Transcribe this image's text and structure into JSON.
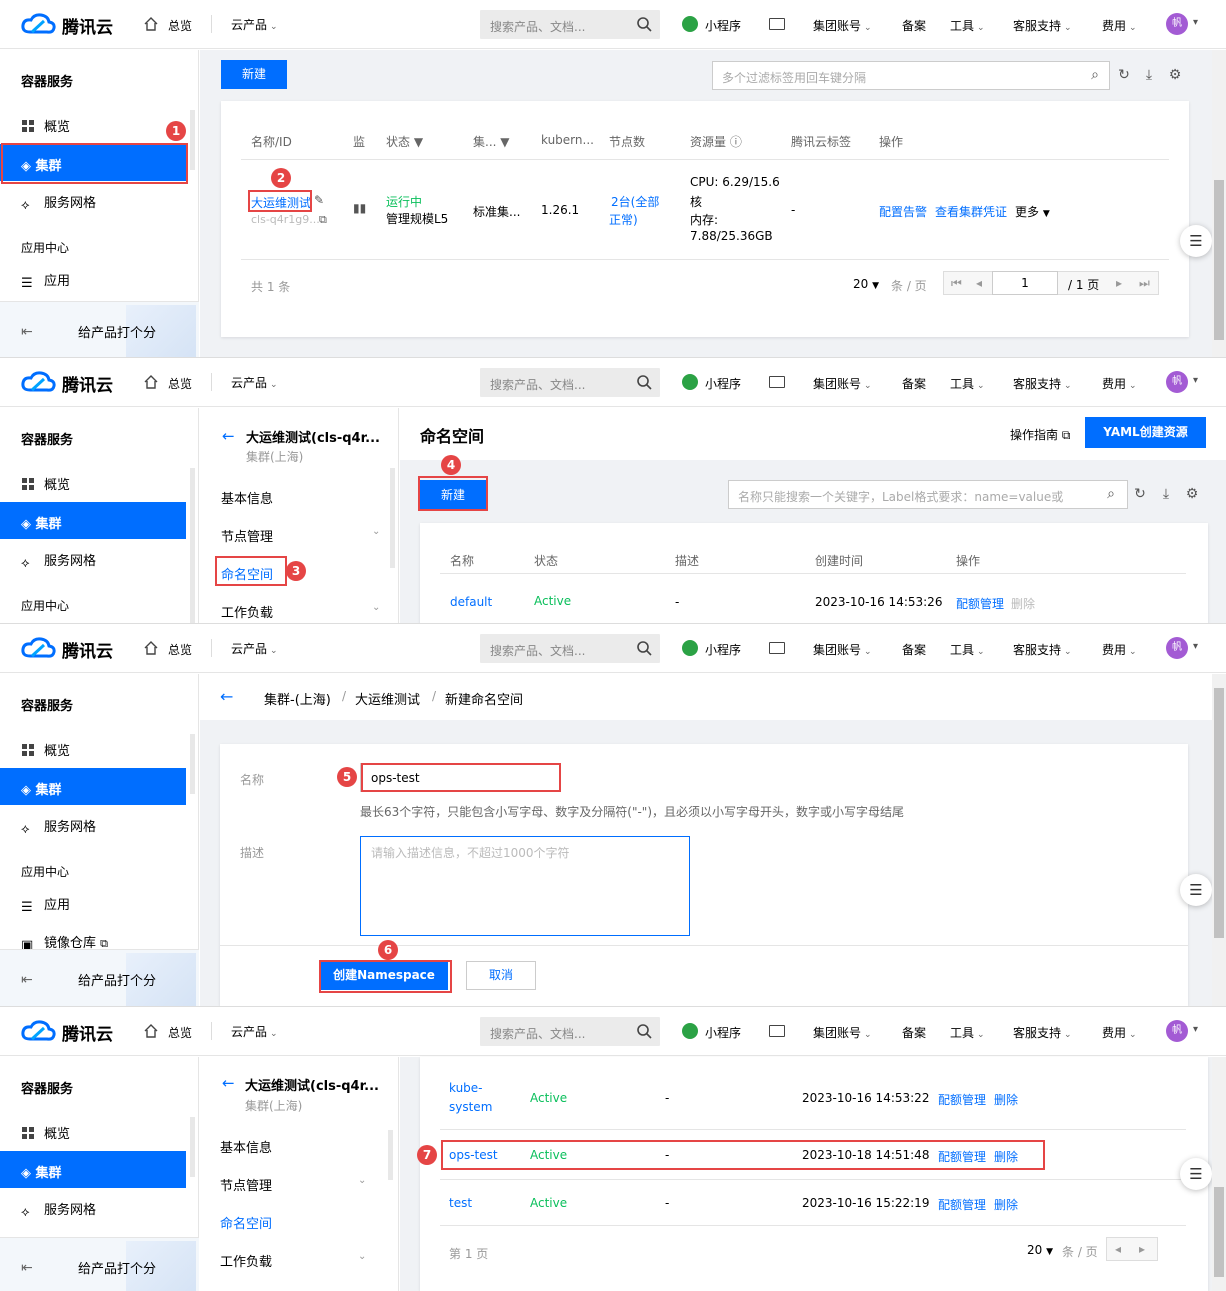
{
  "topbar": {
    "brand": "腾讯云",
    "overview": "总览",
    "products": "云产品",
    "search_placeholder": "搜索产品、文档...",
    "miniprogram": "小程序",
    "group_account": "集团账号",
    "filing": "备案",
    "tools": "工具",
    "support": "客服支持",
    "billing": "费用",
    "avatar": "帆"
  },
  "sidebar": {
    "title": "容器服务",
    "overview": "概览",
    "cluster": "集群",
    "service_mesh": "服务网格",
    "app_center": "应用中心",
    "app": "应用",
    "image_repo": "镜像仓库",
    "rate": "给产品打个分"
  },
  "panel1": {
    "new_button": "新建",
    "filter_placeholder": "多个过滤标签用回车键分隔",
    "columns": [
      "名称/ID",
      "监",
      "状态",
      "集...",
      "kubern...",
      "节点数",
      "资源量",
      "腾讯云标签",
      "操作"
    ],
    "row": {
      "name": "大运维测试",
      "id": "cls-q4r1g9...",
      "status": "运行中",
      "scale": "管理规模L5",
      "type": "标准集...",
      "version": "1.26.1",
      "nodes_a": "2台(全部",
      "nodes_b": "正常)",
      "cpu_a": "CPU: 6.29/15.6",
      "cpu_b": "核",
      "mem_a": "内存:",
      "mem_b": "7.88/25.36GB",
      "tags": "-",
      "op1": "配置告警",
      "op2": "查看集群凭证",
      "op3": "更多"
    },
    "total": "共 1 条",
    "page_size": "20",
    "per_page": "条 / 页",
    "page_num": "1",
    "page_total": "/ 1 页",
    "badge1": "1",
    "badge2": "2"
  },
  "panel2": {
    "cluster_title": "大运维测试(cls-q4r...",
    "cluster_region": "集群(上海)",
    "menu_basic": "基本信息",
    "menu_node": "节点管理",
    "menu_ns": "命名空间",
    "menu_workload": "工作负载",
    "page_title": "命名空间",
    "guide": "操作指南",
    "yaml_button": "YAML创建资源",
    "new_button": "新建",
    "filter_placeholder": "名称只能搜索一个关键字，Label格式要求：name=value或",
    "columns": [
      "名称",
      "状态",
      "描述",
      "创建时间",
      "操作"
    ],
    "row": {
      "name": "default",
      "status": "Active",
      "desc": "-",
      "time": "2023-10-16 14:53:26",
      "op1": "配额管理",
      "op2": "删除"
    },
    "badge3": "3",
    "badge4": "4"
  },
  "panel3": {
    "breadcrumb_cluster": "集群-(上海)",
    "breadcrumb_name": "大运维测试",
    "breadcrumb_page": "新建命名空间",
    "label_name": "名称",
    "name_value": "ops-test",
    "name_hint": "最长63个字符，只能包含小写字母、数字及分隔符(\"-\")，且必须以小写字母开头，数字或小写字母结尾",
    "label_desc": "描述",
    "desc_placeholder": "请输入描述信息，不超过1000个字符",
    "create_button": "创建Namespace",
    "cancel_button": "取消",
    "badge5": "5",
    "badge6": "6"
  },
  "panel4": {
    "rows": [
      {
        "name_a": "kube-",
        "name_b": "system",
        "status": "Active",
        "desc": "-",
        "time": "2023-10-16 14:53:22",
        "op1": "配额管理",
        "op2": "删除"
      },
      {
        "name": "ops-test",
        "status": "Active",
        "desc": "-",
        "time": "2023-10-18 14:51:48",
        "op1": "配额管理",
        "op2": "删除"
      },
      {
        "name": "test",
        "status": "Active",
        "desc": "-",
        "time": "2023-10-16 15:22:19",
        "op1": "配额管理",
        "op2": "删除"
      }
    ],
    "page_info": "第 1 页",
    "page_size": "20",
    "per_page": "条 / 页",
    "badge7": "7"
  }
}
